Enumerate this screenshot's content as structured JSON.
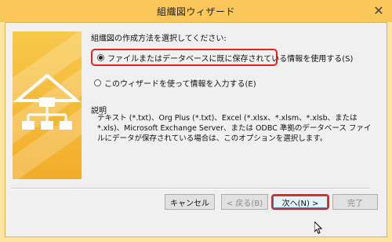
{
  "window": {
    "title": "組織図ウィザード",
    "close_glyph": "✕"
  },
  "main": {
    "heading": "組織図の作成方法を選択してください:",
    "options": [
      {
        "label": "ファイルまたはデータベースに既に保存されている情報を使用する(S)",
        "selected": true
      },
      {
        "label": "このウィザードを使って情報を入力する(E)",
        "selected": false
      }
    ],
    "description_title": "説明",
    "description_text": "テキスト (*.txt)、Org Plus (*.txt)、Excel (*.xlsx、*.xlsm、*.xlsb、または *.xls)、Microsoft Exchange Server、または ODBC 準拠のデータベース ファイルにデータが保存されている場合は、このオプションを選択します。"
  },
  "buttons": {
    "cancel": "キャンセル",
    "back": "< 戻る(B)",
    "next": "次へ(N) >",
    "finish": "完了"
  },
  "colors": {
    "title_bar": "#fbc65a",
    "dialog_bg": "#f0f0f0",
    "highlight_red": "#e0231c",
    "graphic_orange": "#f2ad2a"
  }
}
